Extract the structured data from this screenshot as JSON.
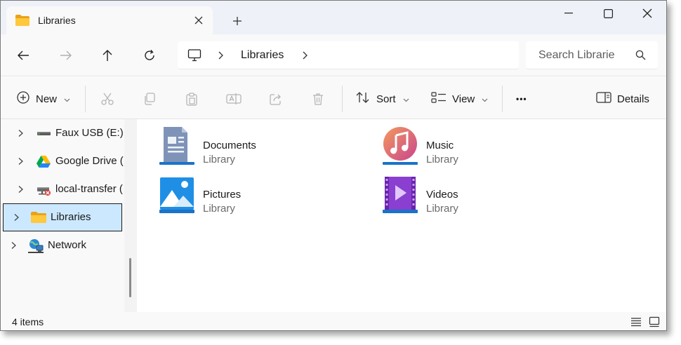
{
  "tab": {
    "title": "Libraries",
    "new_tab_symbol": "+"
  },
  "window_controls": [
    "minimize",
    "maximize",
    "close"
  ],
  "address": {
    "crumbs": [
      "Libraries"
    ]
  },
  "search": {
    "placeholder": "Search Librarie"
  },
  "commands": {
    "new_label": "New",
    "sort_label": "Sort",
    "view_label": "View",
    "more_label": "•••",
    "details_label": "Details"
  },
  "sidebar": {
    "items": [
      {
        "label": "Faux USB (E:)",
        "icon": "usb-drive-icon"
      },
      {
        "label": "Google Drive (",
        "icon": "google-drive-icon"
      },
      {
        "label": "local-transfer (",
        "icon": "network-drive-icon"
      },
      {
        "label": "Libraries",
        "icon": "folder-icon",
        "selected": true
      },
      {
        "label": "Network",
        "icon": "network-icon"
      }
    ]
  },
  "libraries": [
    {
      "name": "Documents",
      "type": "Library",
      "icon": "documents-library-icon"
    },
    {
      "name": "Music",
      "type": "Library",
      "icon": "music-library-icon"
    },
    {
      "name": "Pictures",
      "type": "Library",
      "icon": "pictures-library-icon"
    },
    {
      "name": "Videos",
      "type": "Library",
      "icon": "videos-library-icon"
    }
  ],
  "status": {
    "item_count": "4 items"
  },
  "colors": {
    "selection": "#cce8ff",
    "titlebar": "#eef1f7",
    "accent": "#0067c0"
  }
}
